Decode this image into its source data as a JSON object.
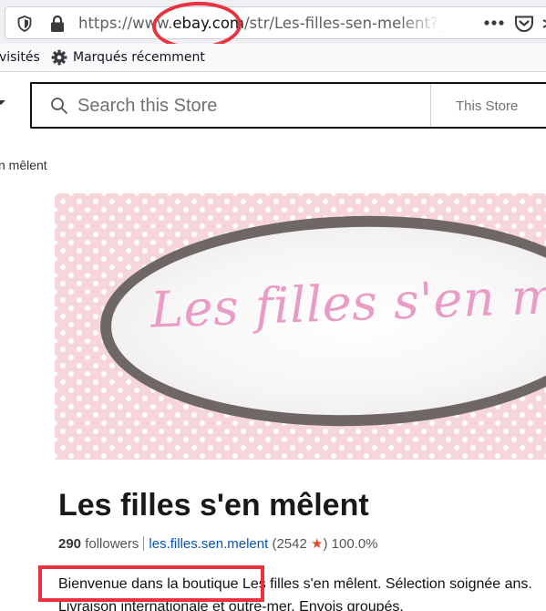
{
  "browser": {
    "url_prefix": "https://www.",
    "url_domain": "ebay.com",
    "url_path": "/str/Les-filles-sen-melent?_trk",
    "bookmarks": {
      "visited_label": "visités",
      "recent_label": "Marqués récemment"
    }
  },
  "search": {
    "placeholder": "Search this Store",
    "scope": "This Store"
  },
  "breadcrumb": "n mêlent",
  "banner": {
    "logo_text": "Les filles s'en mêlent!"
  },
  "store": {
    "title": "Les filles s'en mêlent",
    "followers_count": "290",
    "followers_label": "followers",
    "username": "les.filles.sen.melent",
    "feedback_open": "(2542",
    "feedback_close": ")",
    "positive": "100.0%",
    "description": "Bienvenue dans la boutique Les filles s'en mêlent. Sélection soignée ans. Livraison internationale et outre-mer. Envois groupés."
  },
  "colors": {
    "annotation_red": "#e8323f",
    "link_blue": "#0654ba",
    "star_orange": "#e0472b",
    "banner_pink": "#f6d6d9",
    "logo_pink": "#e99cc6"
  }
}
